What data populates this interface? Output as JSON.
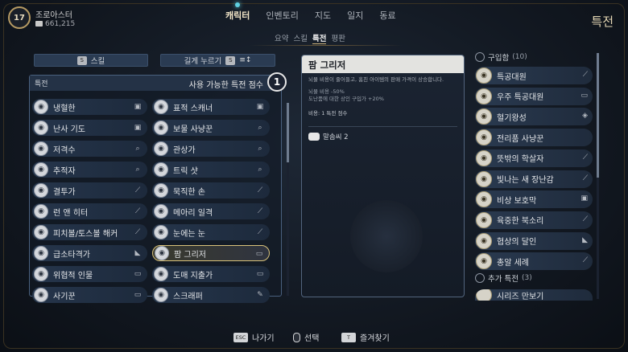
{
  "player": {
    "level": "17",
    "name": "조로아스터",
    "gold": "661,215"
  },
  "nav": {
    "tabs": [
      "캐릭터",
      "인벤토리",
      "지도",
      "일지",
      "동료"
    ],
    "active_tab": "캐릭터",
    "subtabs": [
      "요약",
      "스킬",
      "특전",
      "평판"
    ],
    "active_subtab": "특전",
    "page_title": "특전"
  },
  "filters": {
    "skill": {
      "key": "S",
      "label": "스킬"
    },
    "hold": {
      "label": "길게 누르기",
      "key": "S"
    }
  },
  "perk_list": {
    "header": "특전",
    "available_label": "사용 가능한 특전 점수",
    "available_points": "1",
    "col1": [
      {
        "name": "냉혈한",
        "icon": "perk-icon",
        "status": "lock-icon"
      },
      {
        "name": "난사 기도",
        "icon": "perk-icon",
        "status": "lock-icon"
      },
      {
        "name": "저격수",
        "icon": "perk-icon",
        "status": "magnify-icon"
      },
      {
        "name": "추적자",
        "icon": "perk-icon",
        "status": "magnify-icon"
      },
      {
        "name": "결투가",
        "icon": "perk-icon",
        "status": "blade-icon"
      },
      {
        "name": "런 앤 히터",
        "icon": "perk-icon",
        "status": "blade-icon"
      },
      {
        "name": "피치볼/토스볼 해커",
        "icon": "perk-icon",
        "status": "blade-icon"
      },
      {
        "name": "급소타격가",
        "icon": "perk-icon",
        "status": "shoe-icon"
      },
      {
        "name": "위협적 인물",
        "icon": "perk-icon",
        "status": "chat-icon"
      },
      {
        "name": "사기꾼",
        "icon": "perk-icon",
        "status": "chat-icon"
      }
    ],
    "col2": [
      {
        "name": "표적 스캐너",
        "icon": "perk-icon",
        "status": "lock-icon"
      },
      {
        "name": "보물 사냥꾼",
        "icon": "perk-icon",
        "status": "magnify-icon"
      },
      {
        "name": "관상가",
        "icon": "perk-icon",
        "status": "magnify-icon"
      },
      {
        "name": "트릭 샷",
        "icon": "perk-icon",
        "status": "magnify-icon"
      },
      {
        "name": "묵직한 손",
        "icon": "perk-icon",
        "status": "blade-icon"
      },
      {
        "name": "메아리 일격",
        "icon": "perk-icon",
        "status": "blade-icon"
      },
      {
        "name": "눈에는 눈",
        "icon": "perk-icon",
        "status": "blade-icon"
      },
      {
        "name": "팜 그리저",
        "icon": "perk-icon",
        "status": "chat-icon",
        "selected": true
      },
      {
        "name": "도매 지출가",
        "icon": "perk-icon",
        "status": "chat-icon"
      },
      {
        "name": "스크래퍼",
        "icon": "perk-icon",
        "status": "wrench-icon"
      }
    ]
  },
  "detail": {
    "title": "팜 그리저",
    "desc": "뇌물 비용이 줄어들고, 훔친 아이템의 판매 가격이 상승합니다.",
    "effect1": "뇌물 비용 -50%",
    "effect2": "도난품에 대한 상인 구입가 +20%",
    "cost": "비용: 1 특전 점수",
    "voice": "말솜씨 2"
  },
  "purchased": {
    "header": "구입함",
    "count": "(10)",
    "items": [
      {
        "name": "특공대원",
        "status": "blade-icon"
      },
      {
        "name": "우주 특공대원",
        "status": "chat-icon"
      },
      {
        "name": "혈기왕성",
        "status": "heal-icon"
      },
      {
        "name": "전리품 사냥꾼",
        "status": ""
      },
      {
        "name": "뜻밖의 학살자",
        "status": "blade-icon"
      },
      {
        "name": "빛나는 새 장난감",
        "status": "blade-icon"
      },
      {
        "name": "비상 보호막",
        "status": "lock-icon"
      },
      {
        "name": "육중한 북소리",
        "status": "blade-icon"
      },
      {
        "name": "협상의 달인",
        "status": "shoe-icon"
      },
      {
        "name": "총알 세례",
        "status": "blade-icon"
      }
    ]
  },
  "extra": {
    "header": "추가 특전",
    "count": "(3)",
    "items": [
      {
        "name": "시리즈 만보기"
      }
    ]
  },
  "bottom": {
    "exit": {
      "key": "ESC",
      "label": "나가기"
    },
    "select": {
      "label": "선택"
    },
    "favorite": {
      "key": "T",
      "label": "즐겨찾기"
    }
  }
}
